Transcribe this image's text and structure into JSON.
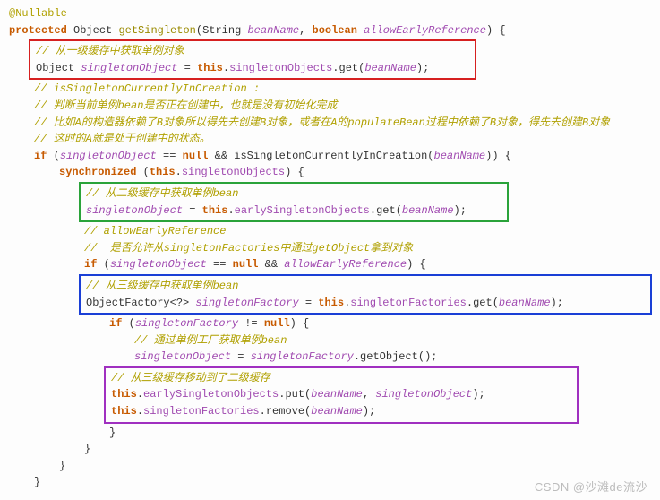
{
  "code": {
    "annotation": "@Nullable",
    "sig_protected": "protected",
    "sig_object": "Object",
    "sig_method": "getSingleton",
    "sig_p1_type": "String",
    "sig_p1_name": "beanName",
    "sig_p2_type": "boolean",
    "sig_p2_name": "allowEarlyReference",
    "c1": "// 从一级缓存中获取单例对象",
    "l1a": "Object ",
    "l1b": "singletonObject",
    "l1c": " = ",
    "l1d": "this",
    "l1e": ".",
    "l1f": "singletonObjects",
    "l1g": ".get(",
    "l1h": "beanName",
    "l1i": ");",
    "c2": "// isSingletonCurrentlyInCreation :",
    "c3": "// 判断当前单例bean是否正在创建中，也就是没有初始化完成",
    "c4": "// 比如A的构造器依赖了B对象所以得先去创建B对象，或者在A的populateBean过程中依赖了B对象，得先去创建B对象",
    "c5": "// 这时的A就是处于创建中的状态。",
    "if1a": "if",
    "if1b": " (",
    "if1c": "singletonObject",
    "if1d": " == ",
    "if1e": "null",
    "if1f": " && isSingletonCurrentlyInCreation(",
    "if1g": "beanName",
    "if1h": ")) {",
    "sync1": "synchronized",
    "sync2": " (",
    "sync3": "this",
    "sync4": ".",
    "sync5": "singletonObjects",
    "sync6": ") {",
    "c6": "// 从二级缓存中获取单例bean",
    "l2a": "singletonObject",
    "l2b": " = ",
    "l2c": "this",
    "l2d": ".",
    "l2e": "earlySingletonObjects",
    "l2f": ".get(",
    "l2g": "beanName",
    "l2h": ");",
    "c7": "// allowEarlyReference",
    "c8": "//  是否允许从singletonFactories中通过getObject拿到对象",
    "if2a": "if",
    "if2b": " (",
    "if2c": "singletonObject",
    "if2d": " == ",
    "if2e": "null",
    "if2f": " && ",
    "if2g": "allowEarlyReference",
    "if2h": ") {",
    "c9": "// 从三级缓存中获取单例bean",
    "l3a": "ObjectFactory<?> ",
    "l3b": "singletonFactory",
    "l3c": " = ",
    "l3d": "this",
    "l3e": ".",
    "l3f": "singletonFactories",
    "l3g": ".get(",
    "l3h": "beanName",
    "l3i": ");",
    "if3a": "if",
    "if3b": " (",
    "if3c": "singletonFactory",
    "if3d": " != ",
    "if3e": "null",
    "if3f": ") {",
    "c10": "// 通过单例工厂获取单例bean",
    "l4a": "singletonObject",
    "l4b": " = ",
    "l4c": "singletonFactory",
    "l4d": ".getObject();",
    "c11": "// 从三级缓存移动到了二级缓存",
    "l5a": "this",
    "l5b": ".",
    "l5c": "earlySingletonObjects",
    "l5d": ".put(",
    "l5e": "beanName",
    "l5f": ", ",
    "l5g": "singletonObject",
    "l5h": ");",
    "l6a": "this",
    "l6b": ".",
    "l6c": "singletonFactories",
    "l6d": ".remove(",
    "l6e": "beanName",
    "l6f": ");",
    "brace_close": "}"
  },
  "watermark": "CSDN @沙滩de流沙"
}
